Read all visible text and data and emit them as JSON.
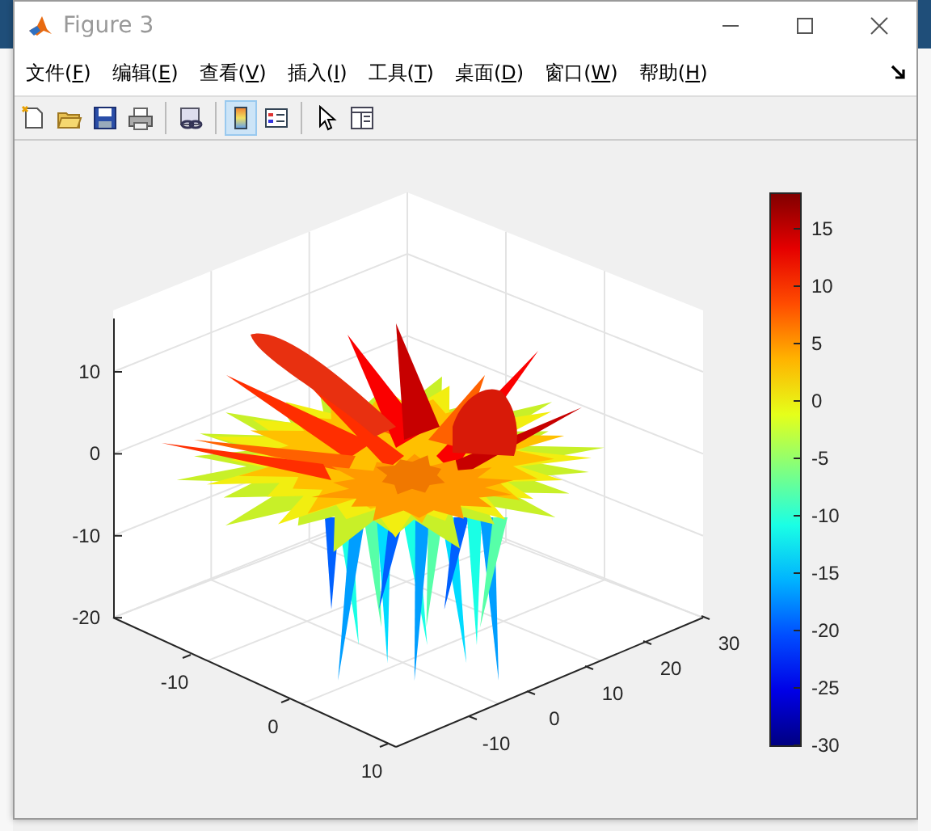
{
  "window": {
    "title": "Figure 3"
  },
  "menu": [
    {
      "label": "文件(F)"
    },
    {
      "label": "编辑(E)"
    },
    {
      "label": "查看(V)"
    },
    {
      "label": "插入(I)"
    },
    {
      "label": "工具(T)"
    },
    {
      "label": "桌面(D)"
    },
    {
      "label": "窗口(W)"
    },
    {
      "label": "帮助(H)"
    }
  ],
  "toolbar": [
    {
      "kind": "new",
      "pressed": false
    },
    {
      "kind": "open",
      "pressed": false
    },
    {
      "kind": "save",
      "pressed": false
    },
    {
      "kind": "print",
      "pressed": false
    },
    {
      "kind": "separator"
    },
    {
      "kind": "link",
      "pressed": false
    },
    {
      "kind": "separator"
    },
    {
      "kind": "colorbar",
      "pressed": true
    },
    {
      "kind": "legend",
      "pressed": false
    },
    {
      "kind": "separator"
    },
    {
      "kind": "pointer",
      "pressed": false
    },
    {
      "kind": "inspector",
      "pressed": false
    }
  ],
  "axes": {
    "z_ticks": [
      "10",
      "0",
      "-10",
      "-20"
    ],
    "x_ticks": [
      "-10",
      "0",
      "10"
    ],
    "y_ticks": [
      "-10",
      "0",
      "10",
      "20",
      "30"
    ]
  },
  "colorbar": {
    "ticks": [
      "15",
      "10",
      "5",
      "0",
      "-5",
      "-10",
      "-15",
      "-20",
      "-25",
      "-30"
    ]
  }
}
